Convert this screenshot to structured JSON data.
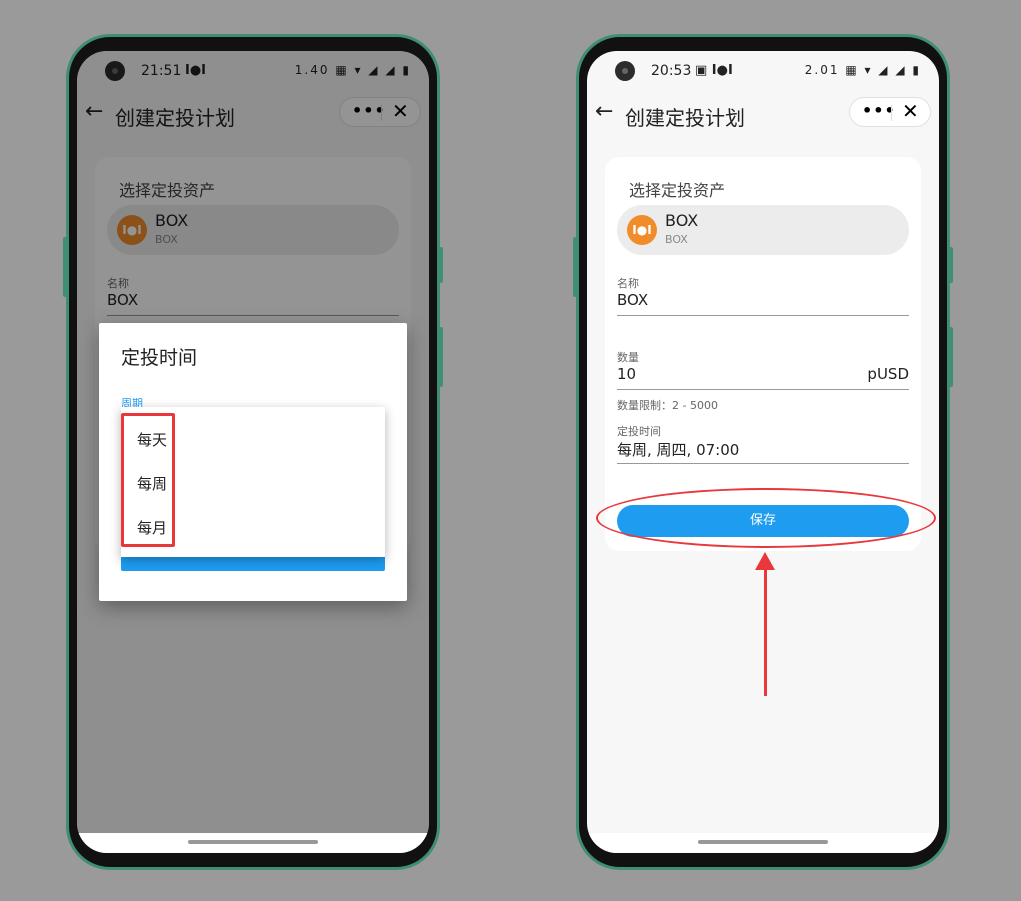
{
  "left_screen": {
    "status": {
      "time": "21:51",
      "app_glyph": "I●I",
      "icons": "1.40 ▦ ▾ ◢ ◢ ▮"
    },
    "nav": {
      "title": "创建定投计划",
      "more": "•••",
      "close": "✕"
    },
    "card": {
      "section_label": "选择定投资产",
      "asset_icon": "I●I",
      "asset_name": "BOX",
      "asset_sub": "BOX",
      "name_label": "名称",
      "name_value": "BOX"
    },
    "dialog": {
      "title": "定投时间",
      "cycle_label": "周期",
      "options": [
        "每天",
        "每周",
        "每月"
      ]
    }
  },
  "right_screen": {
    "status": {
      "time": "20:53",
      "app_glyph": "▣ I●I",
      "icons": "2.01 ▦ ▾ ◢ ◢ ▮"
    },
    "nav": {
      "title": "创建定投计划",
      "more": "•••",
      "close": "✕"
    },
    "card": {
      "section_label": "选择定投资产",
      "asset_icon": "I●I",
      "asset_name": "BOX",
      "asset_sub": "BOX",
      "name_label": "名称",
      "name_value": "BOX",
      "amount_label": "数量",
      "amount_value": "10",
      "amount_unit": "pUSD",
      "amount_hint": "数量限制：2 - 5000",
      "schedule_label": "定投时间",
      "schedule_value": "每周, 周四, 07:00",
      "save_label": "保存"
    }
  },
  "colors": {
    "accent": "#1e9cf0",
    "annotation": "#e8383c",
    "phone_frame": "#3f8f73",
    "asset_icon": "#f08c2a"
  }
}
